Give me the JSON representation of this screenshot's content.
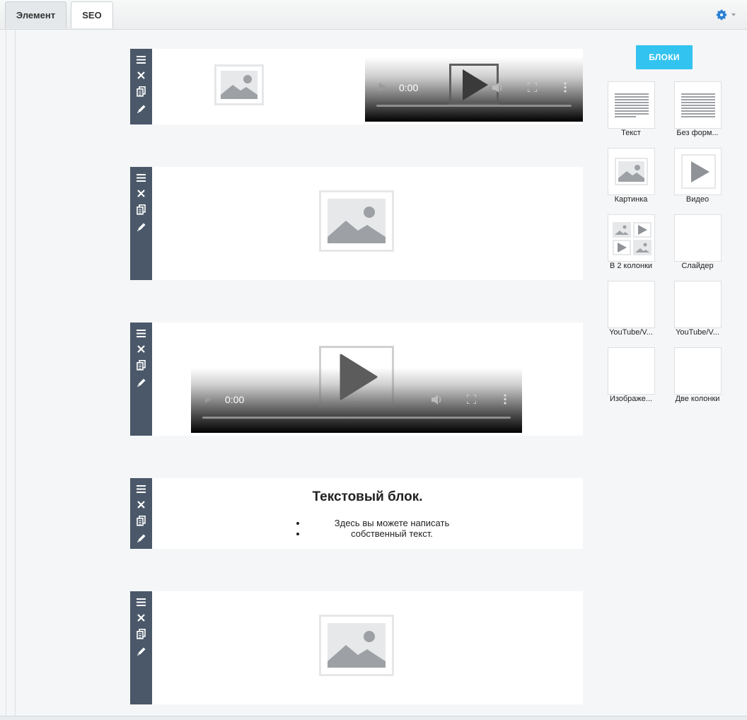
{
  "tabs": [
    {
      "label": "Элемент",
      "active": true
    },
    {
      "label": "SEO",
      "active": false
    }
  ],
  "editor": {
    "video_time": "0:00",
    "text_block": {
      "title": "Текстовый блок.",
      "items": [
        "Здесь вы можете написать",
        "собственный текст."
      ]
    }
  },
  "panel": {
    "button_label": "БЛОКИ",
    "tiles": [
      {
        "label": "Текст",
        "icon": "text-lines-icon"
      },
      {
        "label": "Без форм...",
        "icon": "text-lines-icon"
      },
      {
        "label": "Картинка",
        "icon": "image-icon"
      },
      {
        "label": "Видео",
        "icon": "play-icon"
      },
      {
        "label": "В 2 колонки",
        "icon": "two-columns-icon"
      },
      {
        "label": "Слайдер",
        "icon": ""
      },
      {
        "label": "YouTube/V...",
        "icon": ""
      },
      {
        "label": "YouTube/V...",
        "icon": ""
      },
      {
        "label": "Изображе...",
        "icon": ""
      },
      {
        "label": "Две колонки",
        "icon": ""
      }
    ]
  },
  "colors": {
    "accent": "#32c3f0",
    "toolbar": "#4a5869",
    "gear": "#2a7fd4"
  }
}
